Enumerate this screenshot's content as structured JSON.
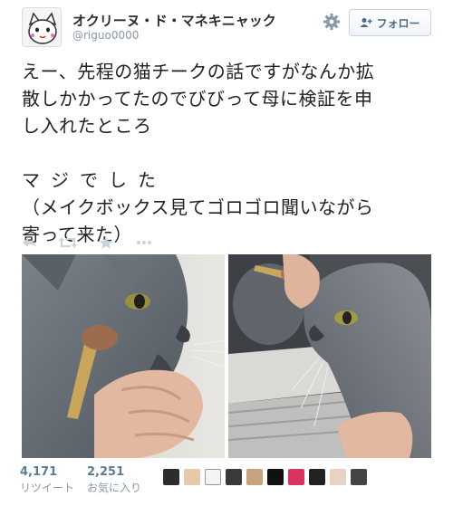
{
  "user": {
    "display_name": "オクリーヌ・ド・マネキニャック",
    "handle": "@riguo0000"
  },
  "follow_button": {
    "label": "フォロー"
  },
  "tweet": {
    "line1": "えー、先程の猫チークの話ですがなんか拡",
    "line2": "散しかかってたのでびびって母に検証を申",
    "line3": "し入れたところ",
    "line4": "マジでした",
    "line5": "（メイクボックス見てゴロゴロ聞いながら",
    "line6": "寄って来た）"
  },
  "stats": {
    "retweets_count": "4,171",
    "retweets_label": "リツイート",
    "favorites_count": "2,251",
    "favorites_label": "お気に入り"
  },
  "icons": {
    "reply": "reply-icon",
    "retweet": "retweet-icon",
    "favorite": "star-icon",
    "more": "more-icon",
    "gear": "gear-icon"
  },
  "colors": {
    "accent": "#5c7b98",
    "muted": "#8899a6",
    "text": "#222222"
  }
}
